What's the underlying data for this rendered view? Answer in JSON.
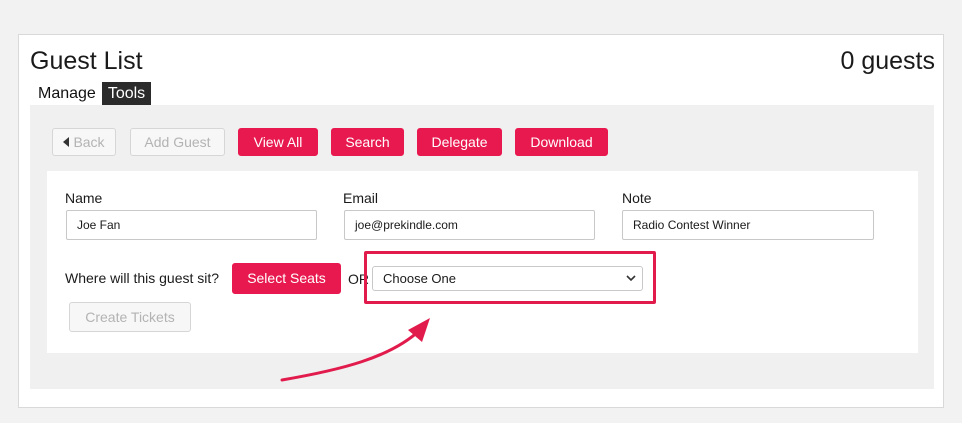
{
  "header": {
    "title": "Guest List",
    "guest_count": "0 guests"
  },
  "tabs": [
    {
      "label": "Manage"
    },
    {
      "label": "Tools"
    }
  ],
  "toolbar": {
    "back": "Back",
    "add_guest": "Add Guest",
    "view_all": "View All",
    "search": "Search",
    "delegate": "Delegate",
    "download": "Download"
  },
  "form": {
    "name_label": "Name",
    "name_value": "Joe Fan",
    "email_label": "Email",
    "email_value": "joe@prekindle.com",
    "note_label": "Note",
    "note_value": "Radio Contest Winner",
    "seat_question": "Where will this guest sit?",
    "select_seats": "Select Seats",
    "or_text": "OR",
    "seat_select_value": "Choose One",
    "create_tickets": "Create Tickets"
  },
  "colors": {
    "accent": "#e8194f",
    "highlight": "#e21b4d",
    "tab_active_bg": "#2b2b2b"
  },
  "icons": {
    "back": "caret-left-icon",
    "select": "chevron-down-icon"
  }
}
